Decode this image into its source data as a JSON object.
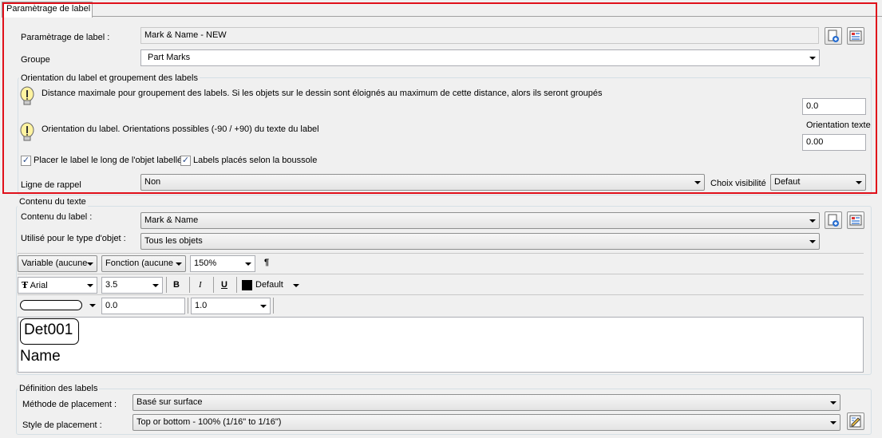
{
  "tab": {
    "label": "Paramètrage de label"
  },
  "header": {
    "label_setting_label": "Paramètrage de label :",
    "label_setting_value": "Mark & Name - NEW",
    "group_label": "Groupe",
    "group_value": "Part Marks"
  },
  "orientation": {
    "title": "Orientation du label et groupement des labels",
    "distance_text": "Distance maximale pour groupement des labels. Si les objets sur le dessin sont éloignés au maximum de cette distance, alors ils seront groupés",
    "distance_value": "0.0",
    "orientation_text": "Orientation du label. Orientations possibles (-90 / +90) du texte du label",
    "orientation_caption": "Orientation texte",
    "orientation_value": "0.00",
    "check_along_object": "Placer le label le long de l'objet labellé",
    "check_compass": "Labels placés selon la boussole",
    "leader_label": "Ligne de rappel",
    "leader_value": "Non",
    "visibility_label": "Choix visibilité",
    "visibility_value": "Defaut"
  },
  "text_content": {
    "title": "Contenu du texte",
    "label_content_label": "Contenu du label :",
    "label_content_value": "Mark & Name",
    "object_type_label": "Utilisé pour le type d'objet :",
    "object_type_value": "Tous les objets",
    "toolbar1": {
      "variable": "Variable (aucune",
      "function": "Fonction (aucune",
      "zoom": "150%",
      "pilcrow": "¶"
    },
    "toolbar2": {
      "font_glyph": "Ŧ",
      "font": "Arial",
      "size": "3.5",
      "bold": "B",
      "italic": "I",
      "underline": "U",
      "color": "Default"
    },
    "toolbar3": {
      "offset": "0.0",
      "scale": "1.0"
    },
    "preview": {
      "line1": "Det001",
      "line2": "Name"
    }
  },
  "label_definition": {
    "title": "Définition des labels",
    "method_label": "Méthode de placement :",
    "method_value": "Basé sur surface",
    "style_label": "Style de placement :",
    "style_value": "Top or bottom - 100% (1/16\" to 1/16\")"
  },
  "colors": {
    "highlight": "#e0101a",
    "check": "#2b4d8c"
  },
  "icons": [
    "add-document-icon",
    "list-edit-icon",
    "lightbulb-icon",
    "chevron-down-icon",
    "edit-style-icon"
  ]
}
